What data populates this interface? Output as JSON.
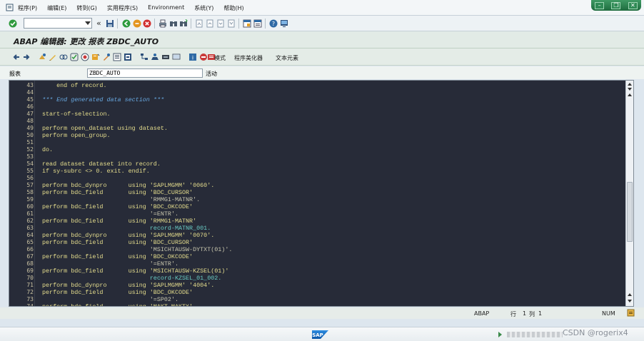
{
  "menubar": {
    "items": [
      "程序(P)",
      "编辑(E)",
      "转到(G)",
      "实用程序(S)",
      "Environment",
      "系统(Y)",
      "帮助(H)"
    ]
  },
  "command_field": {
    "value": ""
  },
  "title": "ABAP 编辑器: 更改 报表 ZBDC_AUTO",
  "app_toolbar": {
    "pattern_label": "模式",
    "pretty_printer_label": "程序美化器",
    "text_elements_label": "文本元素"
  },
  "program": {
    "label": "报表",
    "name": "ZBDC_AUTO",
    "status": "活动"
  },
  "editor": {
    "lines": [
      {
        "n": "43",
        "t": "    end of record.",
        "c": "kw"
      },
      {
        "n": "44",
        "t": "",
        "c": "kw"
      },
      {
        "n": "45",
        "t": "*** End generated data section ***",
        "c": "cm"
      },
      {
        "n": "46",
        "t": "",
        "c": "kw"
      },
      {
        "n": "47",
        "t": "start-of-selection.",
        "c": "kw"
      },
      {
        "n": "48",
        "t": "",
        "c": "kw"
      },
      {
        "n": "49",
        "t": "perform open_dataset using dataset.",
        "c": "kw"
      },
      {
        "n": "50",
        "t": "perform open_group.",
        "c": "kw"
      },
      {
        "n": "51",
        "t": "",
        "c": "kw"
      },
      {
        "n": "52",
        "t": "do.",
        "c": "kw"
      },
      {
        "n": "53",
        "t": "",
        "c": "kw"
      },
      {
        "n": "54",
        "t": "read dataset dataset into record.",
        "c": "kw"
      },
      {
        "n": "55",
        "t": "if sy-subrc <> 0. exit. endif.",
        "c": "kw"
      },
      {
        "n": "56",
        "t": "",
        "c": "kw"
      },
      {
        "n": "57",
        "t": "perform bdc_dynpro      using 'SAPLMGMM' '0060'.",
        "c": "kw"
      },
      {
        "n": "58",
        "t": "perform bdc_field       using 'BDC_CURSOR'",
        "c": "kw"
      },
      {
        "n": "59",
        "t": "                              'RMMG1-MATNR'.",
        "c": "st"
      },
      {
        "n": "60",
        "t": "perform bdc_field       using 'BDC_OKCODE'",
        "c": "kw"
      },
      {
        "n": "61",
        "t": "                              '=ENTR'.",
        "c": "st"
      },
      {
        "n": "62",
        "t": "perform bdc_field       using 'RMMG1-MATNR'",
        "c": "kw"
      },
      {
        "n": "63",
        "t": "                              record-MATNR_001.",
        "c": "pl"
      },
      {
        "n": "64",
        "t": "perform bdc_dynpro      using 'SAPLMGMM' '0070'.",
        "c": "kw"
      },
      {
        "n": "65",
        "t": "perform bdc_field       using 'BDC_CURSOR'",
        "c": "kw"
      },
      {
        "n": "66",
        "t": "                              'MSICHTAUSW-DYTXT(01)'.",
        "c": "st"
      },
      {
        "n": "67",
        "t": "perform bdc_field       using 'BDC_OKCODE'",
        "c": "kw"
      },
      {
        "n": "68",
        "t": "                              '=ENTR'.",
        "c": "st"
      },
      {
        "n": "69",
        "t": "perform bdc_field       using 'MSICHTAUSW-KZSEL(01)'",
        "c": "kw"
      },
      {
        "n": "70",
        "t": "                              record-KZSEL_01_002.",
        "c": "pl"
      },
      {
        "n": "71",
        "t": "perform bdc_dynpro      using 'SAPLMGMM' '4004'.",
        "c": "kw"
      },
      {
        "n": "72",
        "t": "perform bdc_field       using 'BDC_OKCODE'",
        "c": "kw"
      },
      {
        "n": "73",
        "t": "                              '=SP02'.",
        "c": "st"
      },
      {
        "n": "74",
        "t": "perform bdc_field       using 'MAKT-MAKTX'",
        "c": "kw"
      }
    ]
  },
  "editor_status": {
    "language": "ABAP",
    "line_label": "行",
    "line": "1",
    "col_label": "列",
    "col": "1",
    "num": "NUM"
  },
  "statusbar": {
    "logo": "SAP",
    "watermark": "CSDN @rogerix4"
  },
  "colors": {
    "editor_bg": "#272b38",
    "keyword": "#e4dc8c",
    "comment": "#68a8e0",
    "literal": "#c8c6ad",
    "field": "#68c9c2",
    "window_green": "#2f8a55"
  }
}
